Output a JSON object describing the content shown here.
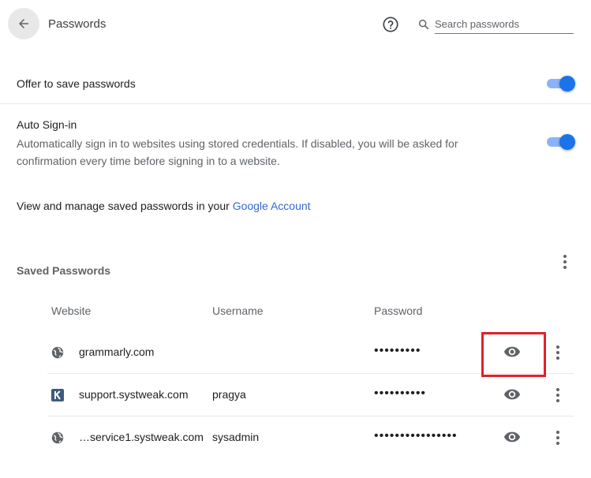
{
  "header": {
    "title": "Passwords",
    "help_icon": "help-circle-icon",
    "search_placeholder": "Search passwords"
  },
  "settings": {
    "offer_to_save": {
      "label": "Offer to save passwords",
      "enabled": true
    },
    "auto_signin": {
      "label": "Auto Sign-in",
      "description": "Automatically sign in to websites using stored credentials. If disabled, you will be asked for confirmation every time before signing in to a website.",
      "enabled": true
    },
    "manage_text": "View and manage saved passwords in your ",
    "manage_link": "Google Account"
  },
  "saved_passwords": {
    "title": "Saved Passwords",
    "columns": [
      "Website",
      "Username",
      "Password"
    ],
    "rows": [
      {
        "site_icon": "globe-icon",
        "website": "grammarly.com",
        "username": "",
        "password_mask": "•••••••••"
      },
      {
        "site_icon": "k-logo-icon",
        "website": "support.systweak.com",
        "username": "pragya",
        "password_mask": "••••••••••"
      },
      {
        "site_icon": "globe-icon",
        "website": "…service1.systweak.com",
        "username": "sysadmin",
        "password_mask": "••••••••••••••••"
      }
    ]
  },
  "colors": {
    "accent": "#1a73e8",
    "link": "#3367d6",
    "highlight": "#e0212a"
  }
}
